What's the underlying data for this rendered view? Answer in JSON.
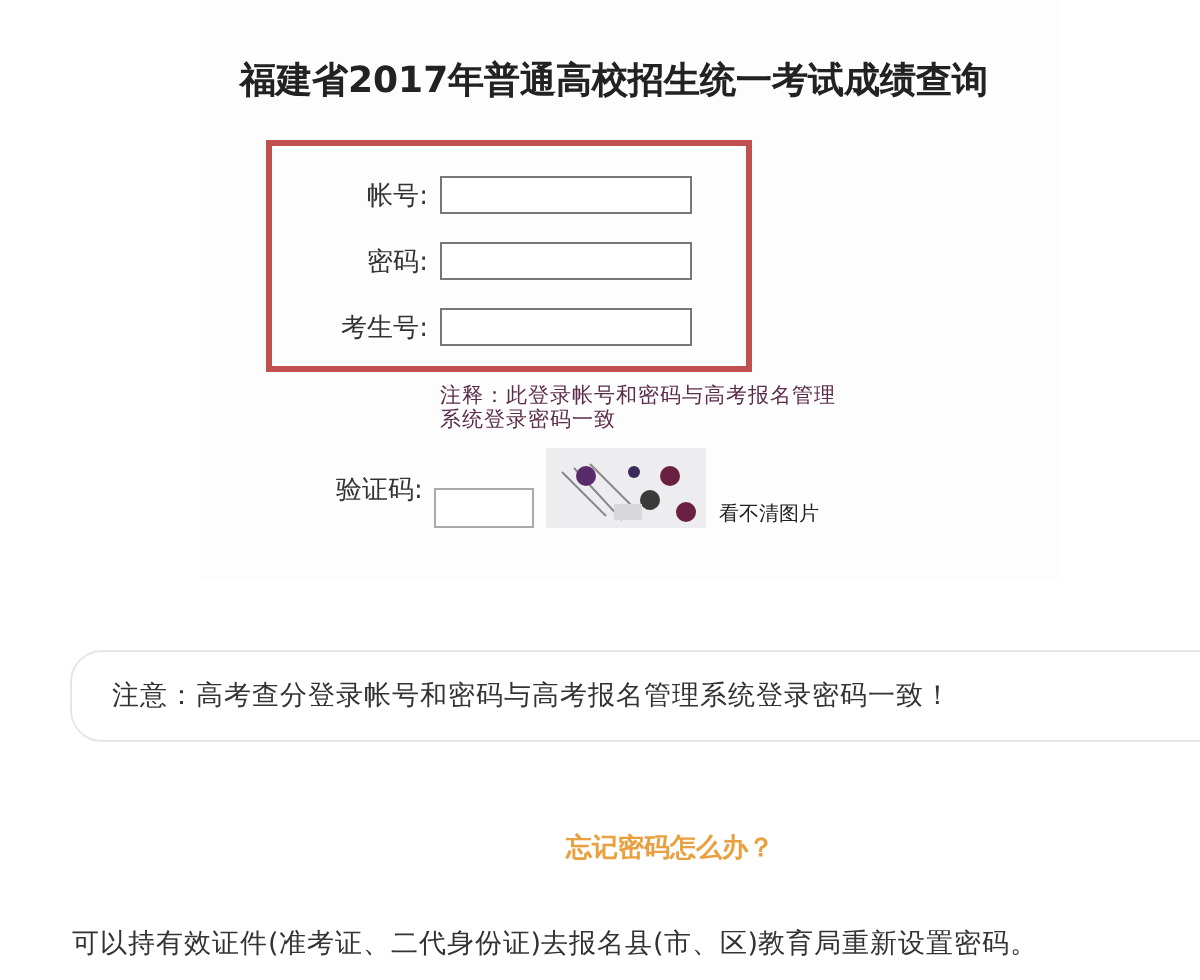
{
  "screenshot": {
    "title": "福建省2017年普通高校招生统一考试成绩查询",
    "fields": [
      {
        "label": "帐号:"
      },
      {
        "label": "密码:"
      },
      {
        "label": "考生号:"
      }
    ],
    "note": "注释：此登录帐号和密码与高考报名管理系统登录密码一致",
    "captcha": {
      "label": "验证码:",
      "refresh_link": "看不清图片"
    }
  },
  "notice": "注意：高考查分登录帐号和密码与高考报名管理系统登录密码一致！",
  "heading": "忘记密码怎么办？",
  "paragraph": "可以持有效证件(准考证、二代身份证)去报名县(市、区)教育局重新设置密码。"
}
